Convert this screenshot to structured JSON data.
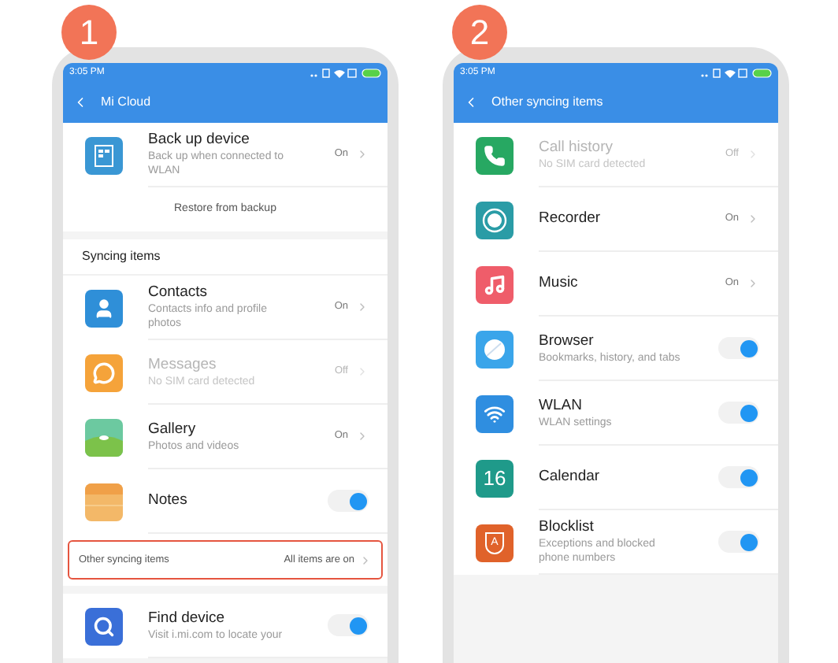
{
  "phones": [
    {
      "badge": "1",
      "status_time": "3:05 PM",
      "title": "Mi Cloud",
      "groups": [
        [
          {
            "kind": "value",
            "title": "Back up device",
            "subtitle": "Back up when connected to WLAN",
            "value": "On",
            "disabled": false,
            "color": "#3a97d4"
          },
          {
            "kind": "action",
            "label": "Restore from backup"
          }
        ],
        [
          {
            "kind": "header",
            "label": "Syncing items"
          },
          {
            "kind": "value",
            "title": "Contacts",
            "subtitle": "Contacts info and profile photos",
            "value": "On",
            "disabled": false,
            "color": "#2f8fd8"
          },
          {
            "kind": "value",
            "title": "Messages",
            "subtitle": "No SIM card detected",
            "value": "Off",
            "disabled": true,
            "color": "#f5a33a"
          },
          {
            "kind": "value",
            "title": "Gallery",
            "subtitle": "Photos and videos",
            "value": "On",
            "disabled": false,
            "color": "#6cc9a0"
          },
          {
            "kind": "toggle",
            "title": "Notes",
            "on": true,
            "disabled": false,
            "color": "#f3b868"
          },
          {
            "kind": "link",
            "label": "Other syncing items",
            "value": "All items are on",
            "highlighted": true
          }
        ],
        [
          {
            "kind": "toggle",
            "title": "Find device",
            "subtitle": "Visit i.mi.com to locate your",
            "on": true,
            "disabled": false,
            "color": "#3a6fd8"
          }
        ]
      ]
    },
    {
      "badge": "2",
      "status_time": "3:05 PM",
      "title": "Other syncing items",
      "groups": [
        [
          {
            "kind": "value",
            "title": "Call history",
            "subtitle": "No SIM card detected",
            "value": "Off",
            "disabled": true,
            "color": "#27a862"
          },
          {
            "kind": "value",
            "title": "Recorder",
            "value": "On",
            "disabled": false,
            "color": "#2a9ca6"
          },
          {
            "kind": "value",
            "title": "Music",
            "value": "On",
            "disabled": false,
            "color": "#ef5d6a"
          },
          {
            "kind": "toggle",
            "title": "Browser",
            "subtitle": "Bookmarks, history, and tabs",
            "on": true,
            "disabled": false,
            "color": "#3aa5ea"
          },
          {
            "kind": "toggle",
            "title": "WLAN",
            "subtitle": "WLAN settings",
            "on": true,
            "disabled": false,
            "color": "#2f8ee0"
          },
          {
            "kind": "toggle",
            "title": "Calendar",
            "on": true,
            "disabled": false,
            "color": "#1f9a8a",
            "icon_text": "16"
          },
          {
            "kind": "toggle",
            "title": "Blocklist",
            "subtitle": "Exceptions and blocked phone numbers",
            "on": true,
            "disabled": false,
            "color": "#e0622a",
            "icon_text": "A"
          }
        ]
      ]
    }
  ]
}
